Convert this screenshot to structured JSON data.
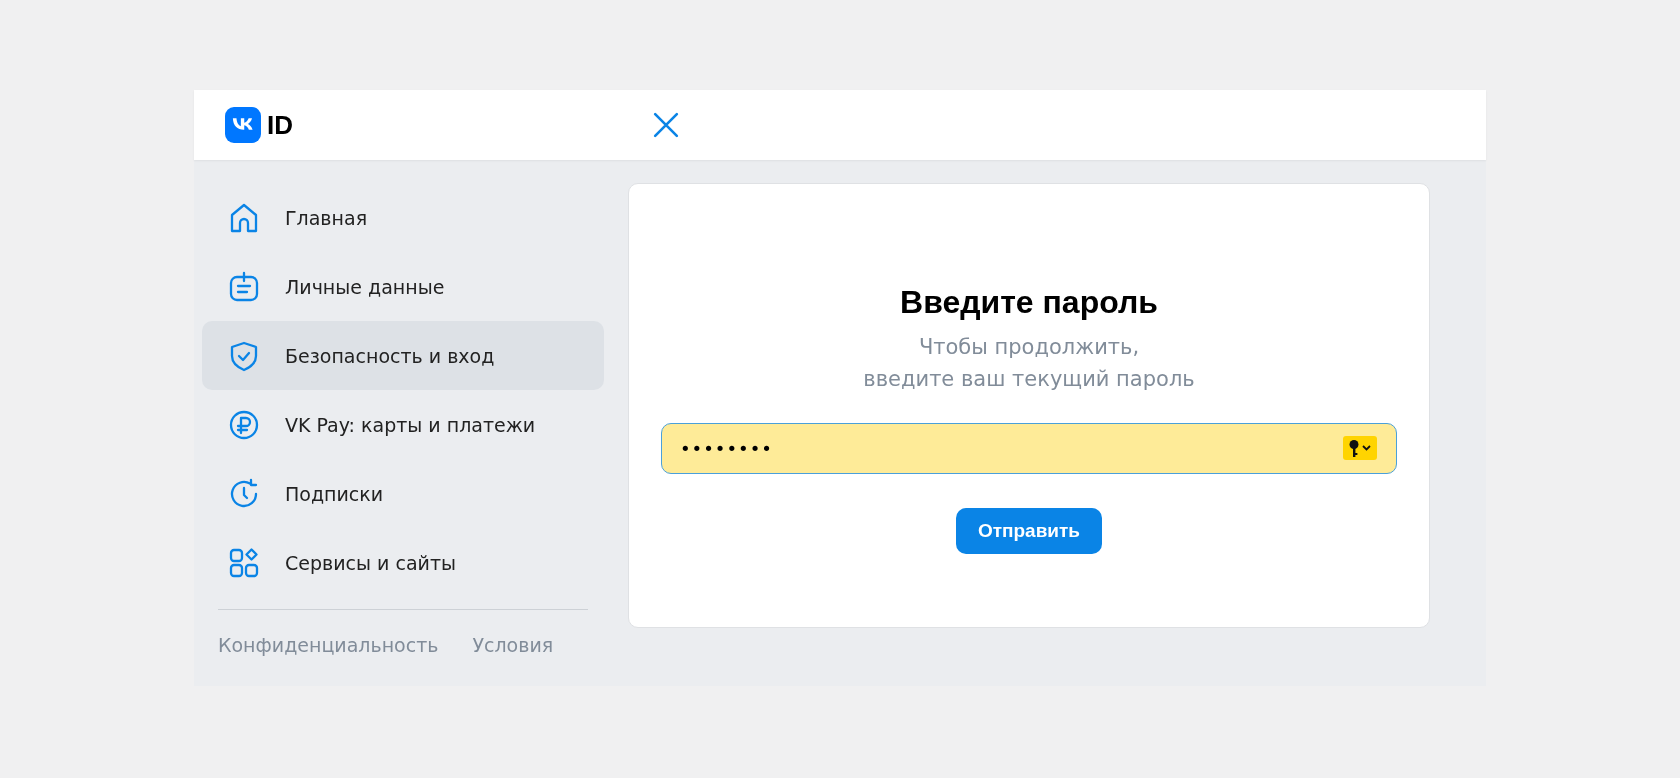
{
  "header": {
    "logo_text": "ID"
  },
  "sidebar": {
    "items": [
      {
        "label": "Главная",
        "selected": false
      },
      {
        "label": "Личные данные",
        "selected": false
      },
      {
        "label": "Безопасность и вход",
        "selected": true
      },
      {
        "label": "VK Pay: карты и платежи",
        "selected": false
      },
      {
        "label": "Подписки",
        "selected": false
      },
      {
        "label": "Сервисы и сайты",
        "selected": false
      }
    ],
    "footer_links": [
      "Конфиденциальность",
      "Условия"
    ]
  },
  "dialog": {
    "title": "Введите пароль",
    "subtitle": [
      "Чтобы продолжить,",
      "введите ваш текущий пароль"
    ],
    "password": {
      "value": "••••••••"
    },
    "submit": "Отправить"
  }
}
